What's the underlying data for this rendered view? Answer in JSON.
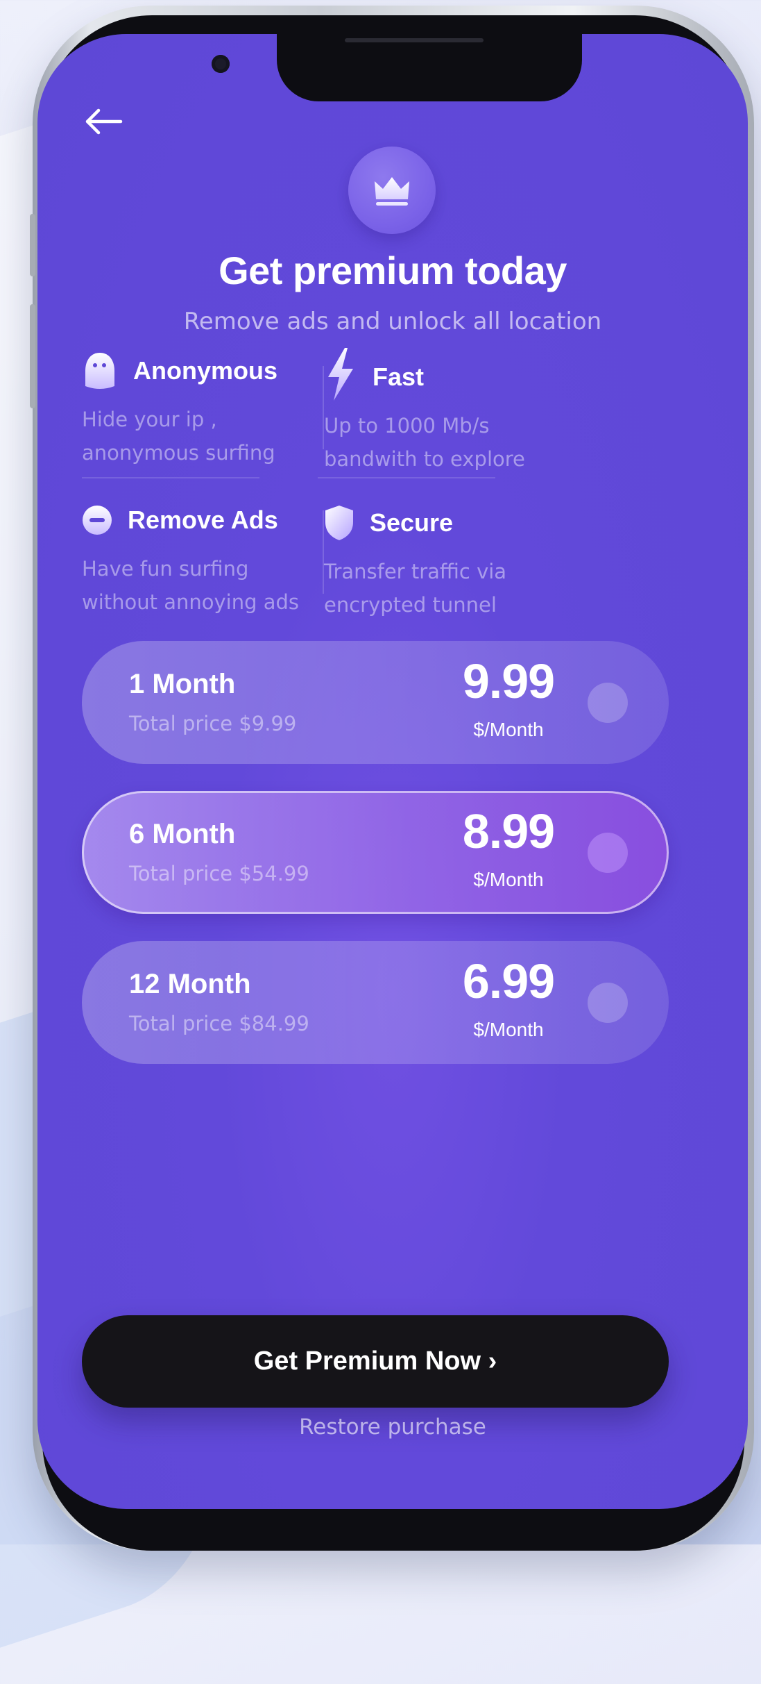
{
  "header": {
    "back_icon": "arrow-left-icon",
    "badge_icon": "crown-icon"
  },
  "hero": {
    "title": "Get premium today",
    "subtitle": "Remove ads and unlock all location"
  },
  "features": [
    {
      "icon": "ghost-icon",
      "title": "Anonymous",
      "desc_line1": "Hide your ip ,",
      "desc_line2": "anonymous surfing"
    },
    {
      "icon": "lightning-icon",
      "title": "Fast",
      "desc_line1": "Up to 1000 Mb/s",
      "desc_line2": "bandwith to explore"
    },
    {
      "icon": "minus-circle-icon",
      "title": "Remove Ads",
      "desc_line1": "Have fun surfing",
      "desc_line2": "without annoying ads"
    },
    {
      "icon": "shield-icon",
      "title": "Secure",
      "desc_line1": "Transfer traffic via",
      "desc_line2": "encrypted tunnel"
    }
  ],
  "plans": [
    {
      "name": "1 Month",
      "total": "Total price $9.99",
      "price": "9.99",
      "unit": "$/Month",
      "selected": false
    },
    {
      "name": "6 Month",
      "total": "Total price $54.99",
      "price": "8.99",
      "unit": "$/Month",
      "selected": true
    },
    {
      "name": "12 Month",
      "total": "Total price $84.99",
      "price": "6.99",
      "unit": "$/Month",
      "selected": false
    }
  ],
  "cta": {
    "label": "Get Premium Now ›"
  },
  "footer": {
    "restore_label": "Restore purchase"
  },
  "colors": {
    "screen_bg": "#5e48d6",
    "cta_bg": "#151418",
    "text_primary": "#ffffff"
  }
}
